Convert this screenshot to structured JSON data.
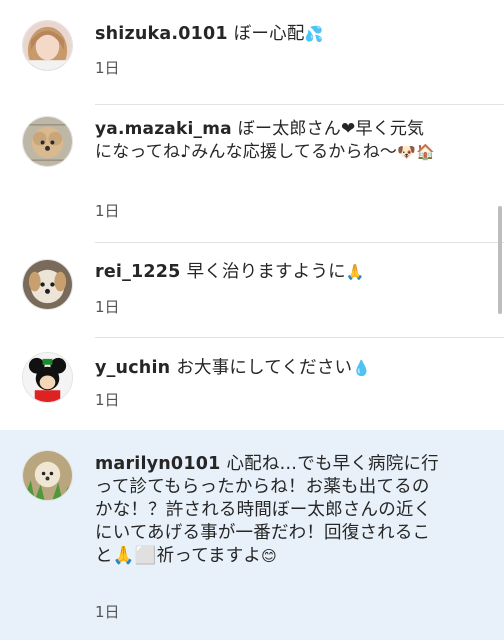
{
  "comments": [
    {
      "username": "shizuka.0101",
      "text": "ぼー心配",
      "emoji": "💦",
      "time": "1日",
      "avatar_icon": "profile-photo-woman"
    },
    {
      "username": "ya.mazaki_ma",
      "text": "ぼー太郎さん❤早く元気になってね♪みんな応援してるからね〜",
      "emoji": "🐶🏠",
      "time": "1日",
      "avatar_icon": "profile-photo-dog-fluffy"
    },
    {
      "username": "rei_1225",
      "text": "早く治りますように",
      "emoji": "🙏",
      "time": "1日",
      "avatar_icon": "profile-photo-puppy"
    },
    {
      "username": "y_uchin",
      "text": "お大事にしてください",
      "emoji": "💧",
      "time": "1日",
      "avatar_icon": "profile-photo-mickey"
    },
    {
      "username": "marilyn0101",
      "text": "心配ね…でも早く病院に行って診てもらったからね！お薬も出てるのかな！？許される時間ぼー太郎さんの近くにいてあげる事が一番だわ！回復されること🙏⬜祈ってますよ",
      "emoji": "😊",
      "time": "1日",
      "avatar_icon": "profile-photo-dog-grass"
    }
  ],
  "colors": {
    "highlight_background": "#e8f1f9",
    "text": "#262626",
    "time": "#555555",
    "divider": "#e2e2e2"
  }
}
